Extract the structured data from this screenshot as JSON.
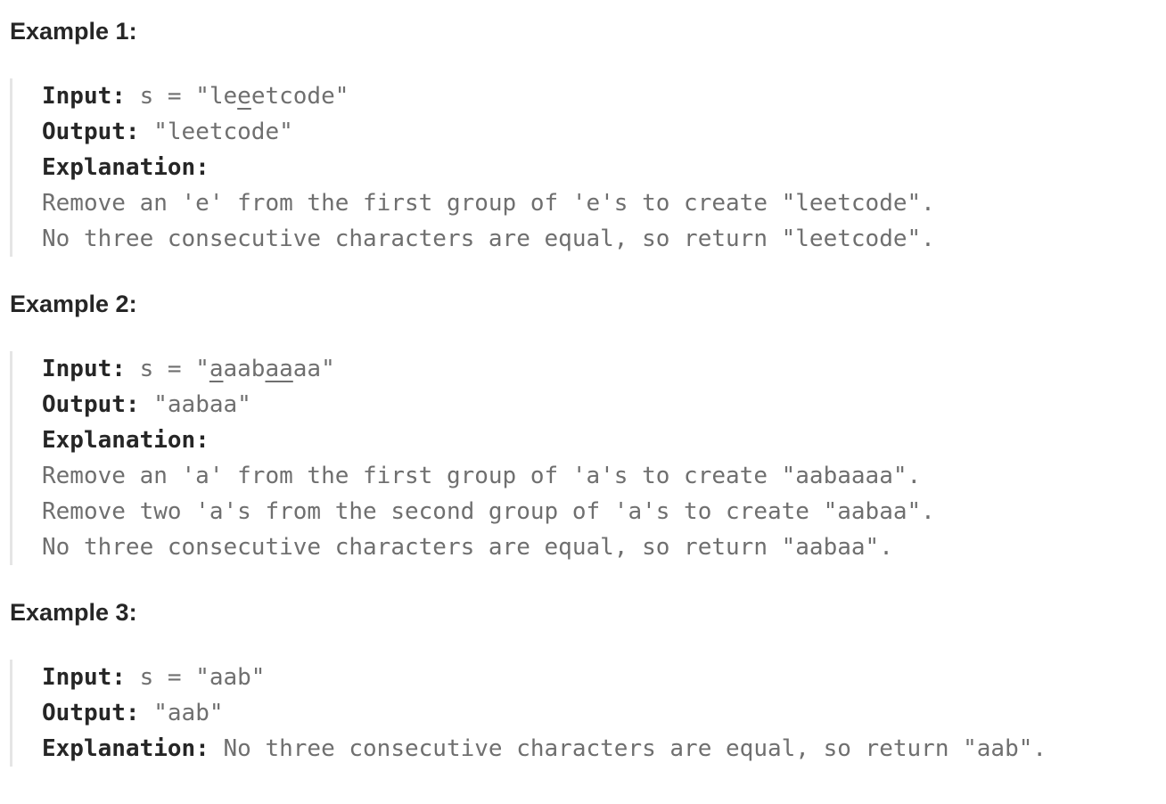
{
  "examples": [
    {
      "heading": "Example 1:",
      "input_label": "Input:",
      "input_prefix": " s = \"le",
      "input_underlined": "e",
      "input_suffix": "etcode\"",
      "output_label": "Output:",
      "output_value": " \"leetcode\"",
      "explanation_label": "Explanation:",
      "explanation_lines": [
        "Remove an 'e' from the first group of 'e's to create \"leetcode\".",
        "No three consecutive characters are equal, so return \"leetcode\"."
      ]
    },
    {
      "heading": "Example 2:",
      "input_label": "Input:",
      "input_parts": [
        " s = \"",
        "a",
        "aab",
        "aa",
        "aa\""
      ],
      "output_label": "Output:",
      "output_value": " \"aabaa\"",
      "explanation_label": "Explanation:",
      "explanation_lines": [
        "Remove an 'a' from the first group of 'a's to create \"aabaaaa\".",
        "Remove two 'a's from the second group of 'a's to create \"aabaa\".",
        "No three consecutive characters are equal, so return \"aabaa\"."
      ]
    },
    {
      "heading": "Example 3:",
      "input_label": "Input:",
      "input_value": " s = \"aab\"",
      "output_label": "Output:",
      "output_value": " \"aab\"",
      "explanation_label": "Explanation:",
      "explanation_inline": " No three consecutive characters are equal, so return \"aab\"."
    }
  ]
}
